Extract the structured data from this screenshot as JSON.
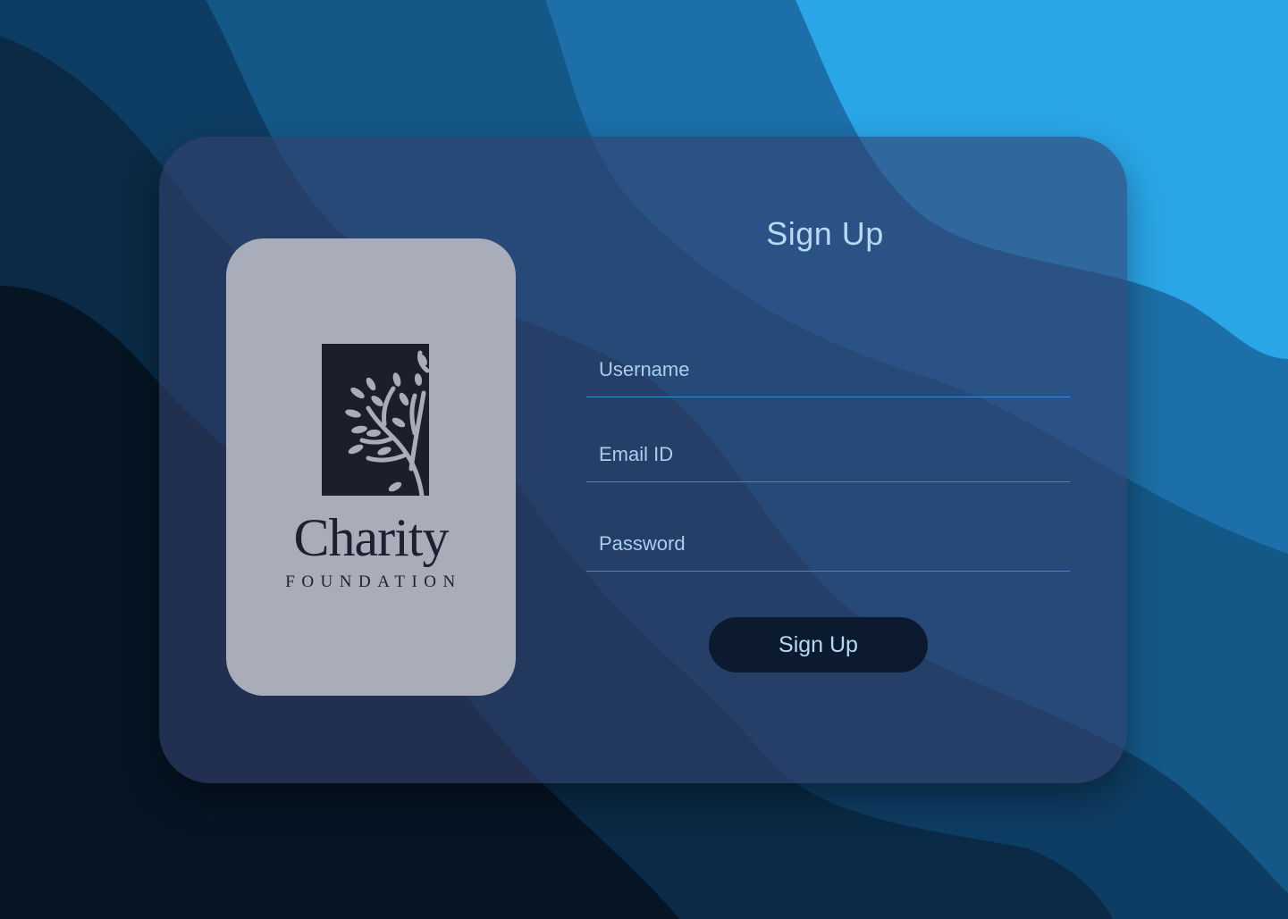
{
  "logo": {
    "name": "Charity",
    "subtitle": "FOUNDATION"
  },
  "form": {
    "title": "Sign Up",
    "username_placeholder": "Username",
    "email_placeholder": "Email ID",
    "password_placeholder": "Password",
    "submit_label": "Sign Up"
  },
  "colors": {
    "accent": "#2f8fd6",
    "text": "#b7d9f3",
    "button_bg": "#0c1a2f",
    "logo_panel": "#a9adb9"
  },
  "icons": [
    "tree-logo-icon"
  ]
}
